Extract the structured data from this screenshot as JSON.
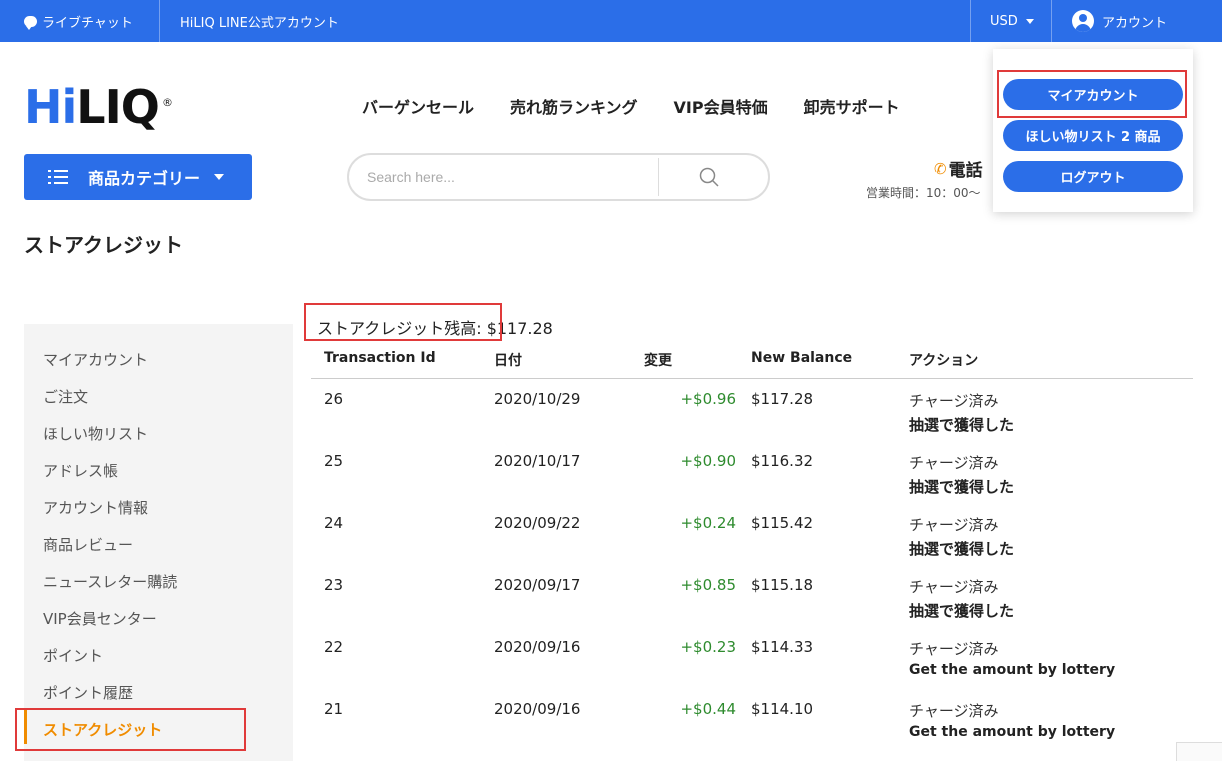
{
  "topbar": {
    "live_chat": "ライブチャット",
    "line_account": "HiLIQ LINE公式アカウント",
    "currency": "USD",
    "account": "アカウント"
  },
  "logo": {
    "hi": "Hi",
    "liq": "LIQ",
    "reg": "®"
  },
  "nav": [
    "バーゲンセール",
    "売れ筋ランキング",
    "VIP会員特価",
    "卸売サポート"
  ],
  "category_button": "商品カテゴリー",
  "search": {
    "placeholder": "Search here..."
  },
  "contact": {
    "phone_label": "電話",
    "hours": "営業時間：10：00〜"
  },
  "account_menu": {
    "my_account": "マイアカウント",
    "wishlist": "ほしい物リスト 2 商品",
    "logout": "ログアウト"
  },
  "page_title": "ストアクレジット",
  "sidebar": {
    "items": [
      "マイアカウント",
      "ご注文",
      "ほしい物リスト",
      "アドレス帳",
      "アカウント情報",
      "商品レビュー",
      "ニュースレター購読",
      "VIP会員センター",
      "ポイント",
      "ポイント履歴",
      "ストアクレジット"
    ],
    "active_index": 10
  },
  "balance": {
    "label": "ストアクレジット残高:",
    "amount": "$117.28"
  },
  "table": {
    "headers": [
      "Transaction Id",
      "日付",
      "変更",
      "New Balance",
      "アクション"
    ],
    "rows": [
      {
        "id": "26",
        "date": "2020/10/29",
        "change": "+$0.96",
        "balance": "$117.28",
        "status": "チャージ済み",
        "note": "抽選で獲得した"
      },
      {
        "id": "25",
        "date": "2020/10/17",
        "change": "+$0.90",
        "balance": "$116.32",
        "status": "チャージ済み",
        "note": "抽選で獲得した"
      },
      {
        "id": "24",
        "date": "2020/09/22",
        "change": "+$0.24",
        "balance": "$115.42",
        "status": "チャージ済み",
        "note": "抽選で獲得した"
      },
      {
        "id": "23",
        "date": "2020/09/17",
        "change": "+$0.85",
        "balance": "$115.18",
        "status": "チャージ済み",
        "note": "抽選で獲得した"
      },
      {
        "id": "22",
        "date": "2020/09/16",
        "change": "+$0.23",
        "balance": "$114.33",
        "status": "チャージ済み",
        "note": "Get the amount by lottery"
      },
      {
        "id": "21",
        "date": "2020/09/16",
        "change": "+$0.44",
        "balance": "$114.10",
        "status": "チャージ済み",
        "note": "Get the amount by lottery"
      }
    ]
  },
  "colors": {
    "brand_blue": "#2b6ee8",
    "accent_orange": "#f08c00",
    "positive_green": "#2e8b2e",
    "highlight_red": "#e03a3a"
  }
}
